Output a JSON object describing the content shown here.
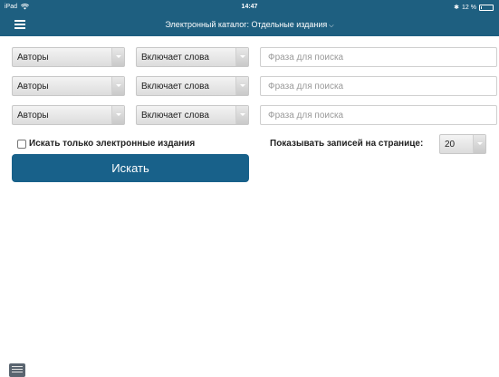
{
  "status_bar": {
    "device": "iPad",
    "time": "14:47",
    "battery": "12 %",
    "battery_level": 0.12
  },
  "header": {
    "title": "Электронный каталог: Отдельные издания",
    "title_chevron": "⌵",
    "menu_icon": "hamburger-menu-icon"
  },
  "search_rows": [
    {
      "field": "Авторы",
      "operator": "Включает слова",
      "placeholder": "Фраза для поиска"
    },
    {
      "field": "Авторы",
      "operator": "Включает слова",
      "placeholder": "Фраза для поиска"
    },
    {
      "field": "Авторы",
      "operator": "Включает слова",
      "placeholder": "Фраза для поиска"
    }
  ],
  "electronic_only": {
    "label": "Искать только электронные издания",
    "checked": false
  },
  "search_button": {
    "label": "Искать"
  },
  "per_page": {
    "label": "Показывать записей на странице:",
    "value": "20"
  },
  "colors": {
    "header_bg": "#1e5f80",
    "button_bg": "#18618a",
    "content_bg": "#ffffff"
  }
}
